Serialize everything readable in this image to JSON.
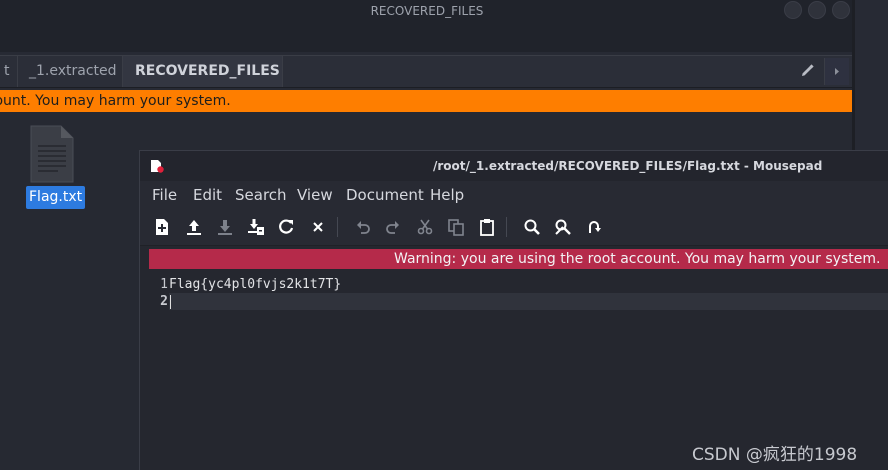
{
  "file_manager": {
    "window_title": "RECOVERED_FILES",
    "tabs": [
      {
        "label": "t",
        "active": false
      },
      {
        "label": "_1.extracted",
        "active": false
      },
      {
        "label": "RECOVERED_FILES",
        "active": true
      }
    ],
    "warning": "ot account. You may harm your system.",
    "files": [
      {
        "name": "Flag.txt",
        "icon": "text-file-icon",
        "selected": true
      }
    ]
  },
  "editor": {
    "window_title": "/root/_1.extracted/RECOVERED_FILES/Flag.txt - Mousepad",
    "menu": [
      "File",
      "Edit",
      "Search",
      "View",
      "Document",
      "Help"
    ],
    "toolbar": [
      "new-file-icon",
      "open-file-icon",
      "save-icon",
      "save-as-icon",
      "reload-icon",
      "close-icon",
      "undo-icon",
      "redo-icon",
      "cut-icon",
      "copy-icon",
      "paste-icon",
      "find-icon",
      "find-replace-icon",
      "go-to-icon"
    ],
    "warning": "Warning: you are using the root account. You may harm your system.",
    "lines": [
      {
        "number": "1",
        "text": "Flag{yc4pl0fvjs2k1t7T}"
      },
      {
        "number": "2",
        "text": ""
      }
    ]
  },
  "watermark": "CSDN @疯狂的1998",
  "colors": {
    "background": "#272a34",
    "orange_warning": "#fe7e00",
    "red_warning": "#b52a4a",
    "selection": "#2d7be0"
  }
}
